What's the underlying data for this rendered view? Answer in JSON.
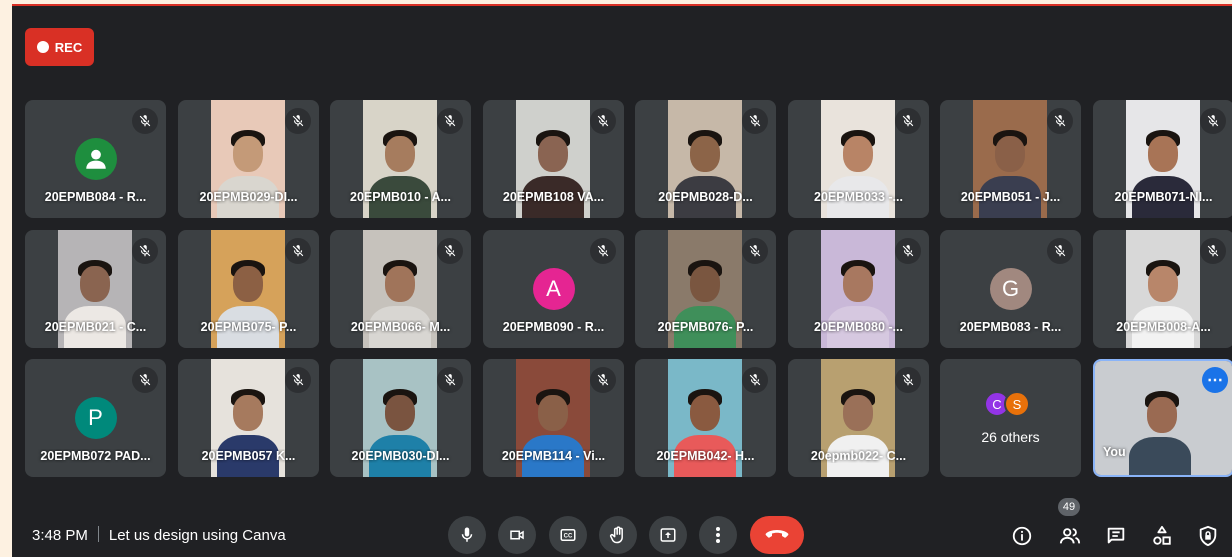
{
  "recording": {
    "label": "REC"
  },
  "meeting": {
    "time": "3:48 PM",
    "title": "Let us design using Canva"
  },
  "participant_count": "49",
  "tiles": [
    {
      "name": "20EPMB084 - R...",
      "avatar": "person",
      "avatar_color": "#1e8e3e"
    },
    {
      "name": "20EPMB029-DI...",
      "video": [
        "#e8c9b8",
        "#c49a78",
        "#d9d6cf"
      ]
    },
    {
      "name": "20EPMB010 - A...",
      "video": [
        "#d8d4c8",
        "#a67c5e",
        "#3a4a3c"
      ]
    },
    {
      "name": "20EPMB108 VA...",
      "video": [
        "#cfd0cc",
        "#8a6452",
        "#3a2a28"
      ]
    },
    {
      "name": "20EPMB028-D...",
      "video": [
        "#c6b8a8",
        "#8c6448",
        "#3c3c42"
      ]
    },
    {
      "name": "20EPMB033 -...",
      "video": [
        "#e9e3dc",
        "#b88466",
        "#e8e8ea"
      ]
    },
    {
      "name": "20EPMB051 - J...",
      "video": [
        "#9a6b4c",
        "#8a6048",
        "#3a3e50"
      ]
    },
    {
      "name": "20EPMB071-NI...",
      "video": [
        "#e6e6e8",
        "#a87456",
        "#2a2a3a"
      ]
    },
    {
      "name": "20EPMB021 - C...",
      "video": [
        "#b6b4b6",
        "#8a6450",
        "#ece8e4"
      ]
    },
    {
      "name": "20EPMB075- P...",
      "video": [
        "#d6a25a",
        "#8c6044",
        "#d9dde2"
      ]
    },
    {
      "name": "20EPMB066- M...",
      "video": [
        "#c6c2bc",
        "#a0745a",
        "#d8d6d2"
      ]
    },
    {
      "name": "20EPMB090 - R...",
      "avatar": "A",
      "avatar_color": "#e52592"
    },
    {
      "name": "20EPMB076- P...",
      "video": [
        "#8a7a6a",
        "#7a5640",
        "#3f8f5a"
      ]
    },
    {
      "name": "20EPMB080 -...",
      "video": [
        "#c9b8d8",
        "#a87860",
        "#d6c8e0"
      ]
    },
    {
      "name": "20EPMB083 - R...",
      "avatar": "G",
      "avatar_color": "#a1887f"
    },
    {
      "name": "20EPMB008-A...",
      "video": [
        "#d8d8d8",
        "#b8866a",
        "#f2f2f2"
      ]
    },
    {
      "name": "20EPMB072 PAD...",
      "avatar": "P",
      "avatar_color": "#00897b"
    },
    {
      "name": "20EPMB057 K...",
      "video": [
        "#e6e2dc",
        "#a67a5e",
        "#2a3a6a"
      ]
    },
    {
      "name": "20EPMB030-DI...",
      "video": [
        "#a8c2c4",
        "#7a5440",
        "#1e80a8"
      ]
    },
    {
      "name": "20EPMB114 - Vi...",
      "video": [
        "#8a4a3a",
        "#8a6048",
        "#2a78c8"
      ]
    },
    {
      "name": "20EPMB042- H...",
      "video": [
        "#7ab8c8",
        "#8a5a40",
        "#e85a5a"
      ]
    },
    {
      "name": "20epmb022- C...",
      "video": [
        "#b8a070",
        "#9a7058",
        "#f0f0f0"
      ]
    },
    {
      "others": "26 others",
      "avatars": [
        {
          "letter": "C",
          "color": "#9334e6"
        },
        {
          "letter": "S",
          "color": "#e8710a"
        }
      ]
    },
    {
      "name": "You",
      "you": true,
      "video": [
        "#c9ccd0",
        "#9a6a52",
        "#3a4a5a"
      ]
    }
  ],
  "icons": {
    "rec": "record-dot-icon",
    "mic_off": "mic-off-icon",
    "controls": [
      "microphone-icon",
      "camera-icon",
      "captions-icon",
      "raise-hand-icon",
      "present-screen-icon",
      "more-options-icon",
      "end-call-icon"
    ],
    "right": [
      "meeting-details-icon",
      "people-icon",
      "chat-icon",
      "activities-icon",
      "host-controls-icon"
    ]
  }
}
